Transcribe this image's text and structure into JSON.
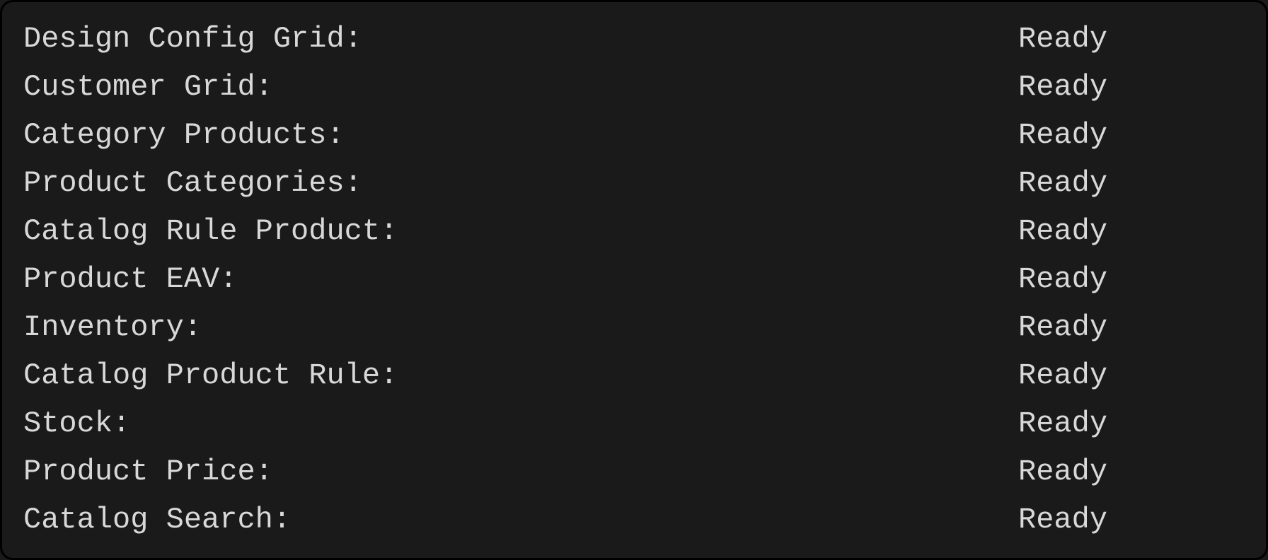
{
  "rows": [
    {
      "label": "Design Config Grid:",
      "status": "Ready"
    },
    {
      "label": "Customer Grid:",
      "status": "Ready"
    },
    {
      "label": "Category Products:",
      "status": "Ready"
    },
    {
      "label": "Product Categories:",
      "status": "Ready"
    },
    {
      "label": "Catalog Rule Product:",
      "status": "Ready"
    },
    {
      "label": "Product EAV:",
      "status": "Ready"
    },
    {
      "label": "Inventory:",
      "status": "Ready"
    },
    {
      "label": "Catalog Product Rule:",
      "status": "Ready"
    },
    {
      "label": "Stock:",
      "status": "Ready"
    },
    {
      "label": "Product Price:",
      "status": "Ready"
    },
    {
      "label": "Catalog Search:",
      "status": "Ready"
    }
  ]
}
